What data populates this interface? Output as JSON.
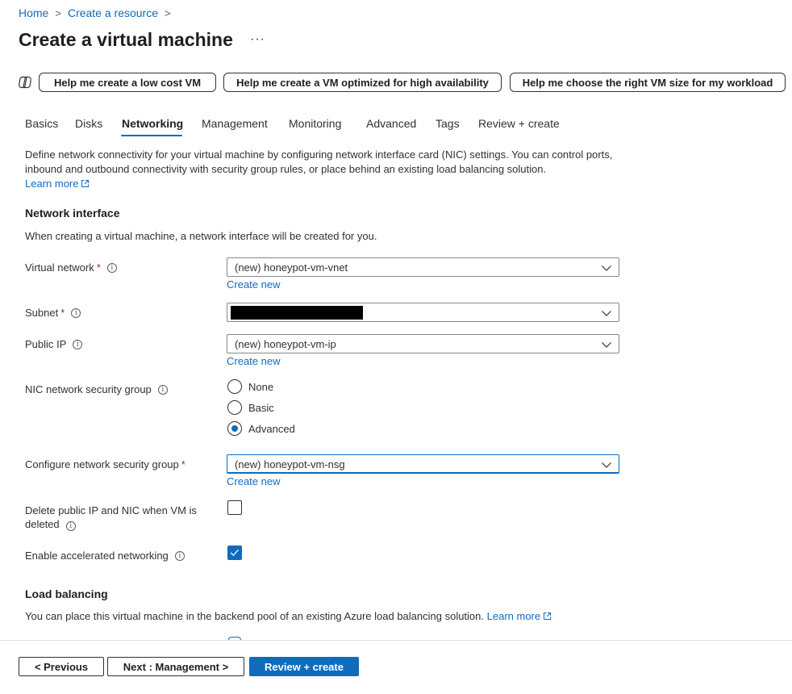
{
  "breadcrumb": {
    "home": "Home",
    "create_resource": "Create a resource",
    "separator": ">"
  },
  "page": {
    "title": "Create a virtual machine",
    "more": "···"
  },
  "copilot": {
    "icon": "copilot-icon",
    "low_cost": "Help me create a low cost VM",
    "high_availability": "Help me create a VM optimized for high availability",
    "vm_size": "Help me choose the right VM size for my workload"
  },
  "tabs": [
    {
      "label": "Basics"
    },
    {
      "label": "Disks"
    },
    {
      "label": "Networking",
      "active": true
    },
    {
      "label": "Management"
    },
    {
      "label": "Monitoring"
    },
    {
      "label": "Advanced"
    },
    {
      "label": "Tags"
    },
    {
      "label": "Review + create"
    }
  ],
  "intro": {
    "text": "Define network connectivity for your virtual machine by configuring network interface card (NIC) settings. You can control ports, inbound and outbound connectivity with security group rules, or place behind an existing load balancing solution.",
    "learn_more": "Learn more"
  },
  "network_interface": {
    "heading": "Network interface",
    "description": "When creating a virtual machine, a network interface will be created for you."
  },
  "fields": {
    "virtual_network": {
      "label": "Virtual network",
      "value": "(new) honeypot-vm-vnet",
      "create_new": "Create new"
    },
    "subnet": {
      "label": "Subnet",
      "value": ""
    },
    "public_ip": {
      "label": "Public IP",
      "value": "(new) honeypot-vm-ip",
      "create_new": "Create new"
    },
    "nic_nsg": {
      "label": "NIC network security group",
      "options": [
        "None",
        "Basic",
        "Advanced"
      ],
      "selected": "Advanced"
    },
    "configure_nsg": {
      "label": "Configure network security group",
      "value": "(new) honeypot-vm-nsg",
      "create_new": "Create new"
    },
    "delete_public_ip": {
      "label_line1": "Delete public IP and NIC when VM is",
      "label_line2": "deleted",
      "checked": false
    },
    "accelerated_networking": {
      "label": "Enable accelerated networking",
      "checked": true
    }
  },
  "required_mark": "*",
  "info_glyph": "i",
  "load_balancing": {
    "heading": "Load balancing",
    "description": "You can place this virtual machine in the backend pool of an existing Azure load balancing solution.",
    "learn_more": "Learn more"
  },
  "footer": {
    "previous": "< Previous",
    "next": "Next : Management >",
    "review": "Review + create"
  },
  "colors": {
    "accent": "#0f6cbd",
    "required": "#a4262c",
    "text": "#323130"
  }
}
